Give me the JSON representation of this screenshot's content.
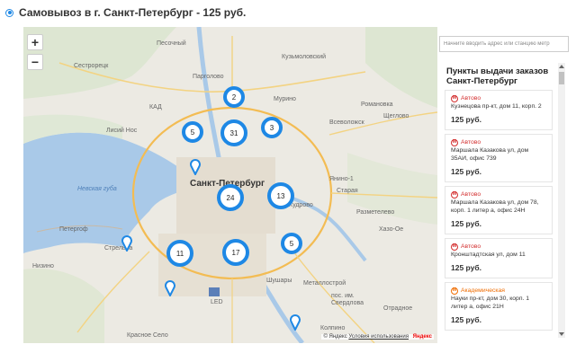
{
  "header": {
    "text": "Самовывоз в г. Санкт-Петербург - 125 руб."
  },
  "map": {
    "zoom_in": "+",
    "zoom_out": "−",
    "labels": {
      "pesochny": "Песочный",
      "kuzmolovsky": "Кузьмоловский",
      "sestroretsk": "Сестрорецк",
      "pargolovo": "Парголово",
      "murino": "Мурино",
      "romanovka": "Романовка",
      "shcheglovo": "Щеглово",
      "vsevolozhsk": "Всеволожск",
      "lisiy_nos": "Лисий Нос",
      "saint_petersburg": "Санкт-Петербург",
      "yanino": "Янино-1",
      "nevskaya_guba": "Невская губа",
      "staraya": "Старая",
      "kudrovo": "Кудрово",
      "razmetelevo": "Разметелево",
      "khazo_oe": "Хазо-Ое",
      "petergof": "Петергоф",
      "strelna": "Стрельна",
      "nizino": "Низино",
      "shushary": "Шушары",
      "metallostroy": "Металлострой",
      "led": "LED",
      "sverdlova": "пос. им. Свердлова",
      "otradnoe": "Отрадное",
      "kolpino": "Колпино",
      "krasnoe_selo": "Красное Село",
      "kad": "КАД"
    },
    "clusters": [
      {
        "count": "2"
      },
      {
        "count": "5"
      },
      {
        "count": "31"
      },
      {
        "count": "3"
      },
      {
        "count": "24"
      },
      {
        "count": "13"
      },
      {
        "count": "11"
      },
      {
        "count": "17"
      },
      {
        "count": "5"
      }
    ],
    "copyright": "© Яндекс",
    "terms": "Условия использования",
    "brand": "Яндекс"
  },
  "sidebar": {
    "search_placeholder": "Начните вводить адрес или станцию метр",
    "title": "Пункты выдачи заказов Санкт-Петербург",
    "items": [
      {
        "metro_icon": "М",
        "metro": "Автово",
        "address": "Кузнецова пр-кт, дом 11, корп. 2",
        "price": "125 руб."
      },
      {
        "metro_icon": "М",
        "metro": "Автово",
        "address": "Маршала Казакова ул, дом 35АИ, офис 739",
        "price": "125 руб."
      },
      {
        "metro_icon": "М",
        "metro": "Автово",
        "address": "Маршала Казакова ул, дом 78, корп. 1 литер а, офис 24Н",
        "price": "125 руб."
      },
      {
        "metro_icon": "М",
        "metro": "Автово",
        "address": "Кронштадтская ул, дом 11",
        "price": "125 руб."
      },
      {
        "metro_icon": "М",
        "metro": "Академическая",
        "address": "Науки пр-кт, дом 30, корп. 1 литер а, офис 21Н",
        "price": "125 руб."
      }
    ]
  },
  "colors": {
    "accent": "#1e88e5",
    "metro_red": "#d32f2f",
    "metro_orange": "#ef6c00",
    "water": "#a9c9e8",
    "land": "#eceae3"
  }
}
